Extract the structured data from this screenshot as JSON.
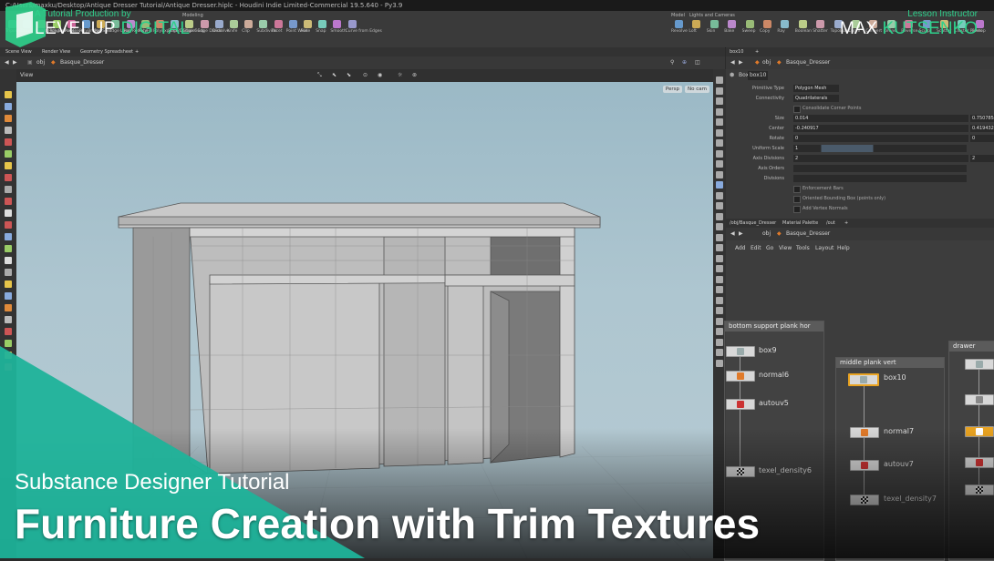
{
  "window": {
    "title": "C:/Users/maxku/Desktop/Antique Dresser Tutorial/Antique Dresser.hiplc - Houdini Indie Limited-Commercial 19.5.640 - Py3.9"
  },
  "shelf": {
    "tabs": [
      "Modeling"
    ],
    "right_tabs": [
      "Model",
      "Lights and Cameras"
    ],
    "tools_left": [
      "Tripod/Box",
      "Draw",
      "Curve Polygon",
      "PolyExtrude",
      "PolyBevel",
      "PolyBridge",
      "PolySplit",
      "Edge Loop",
      "PolyReduce",
      "PolyFill",
      "PolyExpand2D",
      "Edge Collapse",
      "Edge Cusp",
      "Edge Divide",
      "Dissolve",
      "Knife",
      "Clip",
      "Subdivide",
      "Facet",
      "Point Weld",
      "Fuse",
      "Snap",
      "Smooth",
      "Curve from Edges"
    ],
    "tools_right": [
      "Revolve",
      "Loft",
      "Skin",
      "Bake",
      "Sweep",
      "Copy",
      "Ray",
      "Boolean",
      "Shatter",
      "TopoBuild",
      "Curve",
      "Convert",
      "Refine",
      "Reverse",
      "Sculpt",
      "Scatter",
      "Cluster Points",
      "Sweep"
    ]
  },
  "pane_tabs": [
    "Scene View",
    "Render View",
    "Geometry Spreadsheet"
  ],
  "path": {
    "root": "obj",
    "object": "Basque_Dresser"
  },
  "viewport": {
    "label": "View",
    "camera_persp": "Persp",
    "camera_cam": "No cam"
  },
  "params": {
    "tab": "box10",
    "node_type": "Box",
    "node_name": "box10",
    "rows": [
      {
        "label": "Primitive Type",
        "value": "Polygon Mesh"
      },
      {
        "label": "Connectivity",
        "value": "Quadrilaterals"
      },
      {
        "label": "",
        "value": "Consolidate Corner Points"
      },
      {
        "label": "Size",
        "value": "0.014",
        "value2": "0.750785"
      },
      {
        "label": "Center",
        "value": "-0.240917",
        "value2": "0.419432"
      },
      {
        "label": "Rotate",
        "value": "0",
        "value2": "0"
      },
      {
        "label": "Uniform Scale",
        "value": "1"
      },
      {
        "label": "Axis Divisions",
        "value": "2",
        "value2": "2"
      },
      {
        "label": "Axis Orders",
        "value": ""
      },
      {
        "label": "Divisions",
        "value": ""
      },
      {
        "label": "",
        "value": "Enforcement Bars"
      },
      {
        "label": "",
        "value": "Oriented Bounding Box (points only)"
      },
      {
        "label": "",
        "value": "Add Vertex Normals"
      }
    ]
  },
  "network": {
    "tabs": [
      "/obj/Basque_Dresser",
      "Material Palette",
      "/out"
    ],
    "path": {
      "root": "obj",
      "object": "Basque_Dresser"
    },
    "menu": [
      "Add",
      "Edit",
      "Go",
      "View",
      "Tools",
      "Layout",
      "Help"
    ],
    "boxes": [
      {
        "title": "bottom support plank hor",
        "nodes": [
          "box9",
          "normal6",
          "autouv5",
          "texel_density6"
        ]
      },
      {
        "title": "middle plank vert",
        "nodes": [
          "box10",
          "normal7",
          "autouv7",
          "texel_density7"
        ]
      },
      {
        "title": "drawer",
        "nodes": []
      }
    ]
  },
  "branding": {
    "production": "A Tutorial Production by",
    "brand_part1": "LEVELUP",
    "brand_part2": "DIGITAL",
    "instructor_label": "Lesson Instructor",
    "instructor_first": "MAX",
    "instructor_last": "KUTSENKO"
  },
  "titles": {
    "subtitle": "Substance Designer Tutorial",
    "main": "Furniture Creation with Trim Textures"
  },
  "colors": {
    "accent_teal": "#1fb39a",
    "accent_green": "#2fd18c",
    "node_selected": "#e9a321"
  }
}
